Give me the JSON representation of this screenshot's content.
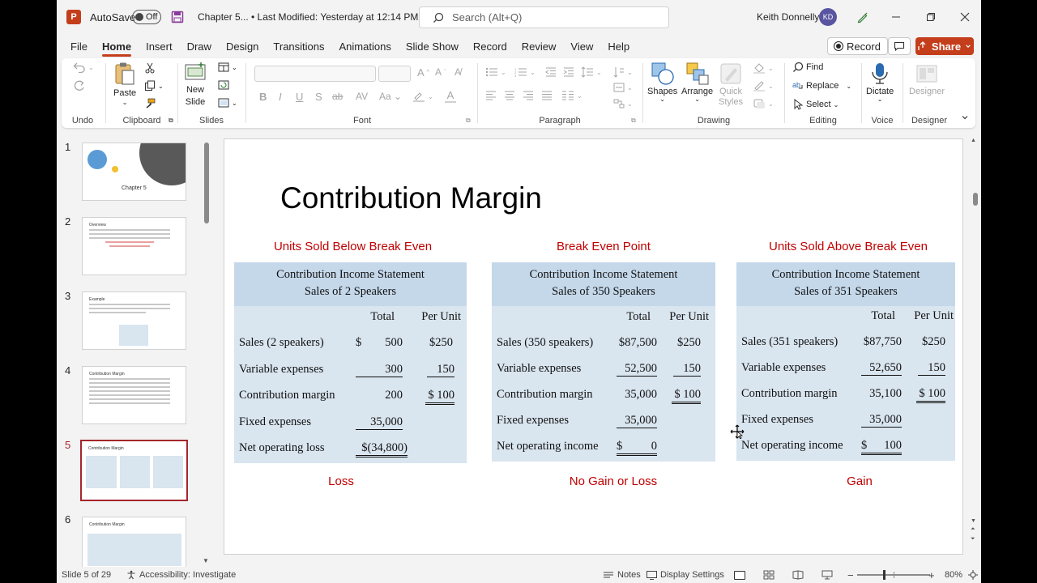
{
  "titlebar": {
    "autosave_label": "AutoSave",
    "autosave_state": "Off",
    "file_name": "Chapter 5...",
    "last_modified": "• Last Modified: Yesterday at 12:14 PM",
    "search_placeholder": "Search (Alt+Q)",
    "user_name": "Keith Donnelly",
    "user_initials": "KD"
  },
  "menu": {
    "tabs": [
      "File",
      "Home",
      "Insert",
      "Draw",
      "Design",
      "Transitions",
      "Animations",
      "Slide Show",
      "Record",
      "Review",
      "View",
      "Help"
    ],
    "active": "Home",
    "record_label": "Record",
    "share_label": "Share"
  },
  "ribbon": {
    "groups": {
      "undo": "Undo",
      "clipboard": "Clipboard",
      "slides": "Slides",
      "font": "Font",
      "paragraph": "Paragraph",
      "drawing": "Drawing",
      "editing": "Editing",
      "voice": "Voice",
      "designer": "Designer"
    },
    "paste_label": "Paste",
    "new_slide_label_1": "New",
    "new_slide_label_2": "Slide",
    "shapes_label": "Shapes",
    "arrange_label": "Arrange",
    "quick_styles_label_1": "Quick",
    "quick_styles_label_2": "Styles",
    "find_label": "Find",
    "replace_label": "Replace",
    "select_label": "Select",
    "dictate_label": "Dictate",
    "designer_label": "Designer"
  },
  "thumbnails": [
    {
      "num": "1",
      "title": "Chapter 5"
    },
    {
      "num": "2",
      "title": "Overview"
    },
    {
      "num": "3",
      "title": "Example"
    },
    {
      "num": "4",
      "title": "Contribution Margin"
    },
    {
      "num": "5",
      "title": "Contribution Margin"
    },
    {
      "num": "6",
      "title": "Contribution Margin"
    }
  ],
  "slide": {
    "title": "Contribution Margin",
    "columns": [
      {
        "heading": "Units Sold Below Break Even",
        "footer": "Loss",
        "statement_title": "Contribution Income Statement",
        "statement_subtitle": "Sales of 2 Speakers",
        "col_total": "Total",
        "col_unit": "Per Unit",
        "rows": [
          {
            "label": "Sales (2 speakers)",
            "cur": "$",
            "total": "500",
            "unit": "$250"
          },
          {
            "label": "Variable expenses",
            "cur": "",
            "total": "300",
            "unit": "150"
          },
          {
            "label": "Contribution margin",
            "cur": "",
            "total": "200",
            "unit": "$ 100"
          },
          {
            "label": "Fixed expenses",
            "cur": "",
            "total": "35,000",
            "unit": ""
          },
          {
            "label": "Net operating loss",
            "cur": "",
            "total": "$(34,800)",
            "unit": ""
          }
        ]
      },
      {
        "heading": "Break Even Point",
        "footer": "No Gain or Loss",
        "statement_title": "Contribution Income Statement",
        "statement_subtitle": "Sales of 350 Speakers",
        "col_total": "Total",
        "col_unit": "Per Unit",
        "rows": [
          {
            "label": "Sales (350 speakers)",
            "cur": "",
            "total": "$87,500",
            "unit": "$250"
          },
          {
            "label": "Variable expenses",
            "cur": "",
            "total": "52,500",
            "unit": "150"
          },
          {
            "label": "Contribution margin",
            "cur": "",
            "total": "35,000",
            "unit": "$ 100"
          },
          {
            "label": "Fixed expenses",
            "cur": "",
            "total": "35,000",
            "unit": ""
          },
          {
            "label": "Net operating income",
            "cur": "$",
            "total": "0",
            "unit": ""
          }
        ]
      },
      {
        "heading": "Units Sold Above Break Even",
        "footer": "Gain",
        "statement_title": "Contribution Income Statement",
        "statement_subtitle": "Sales of 351 Speakers",
        "col_total": "Total",
        "col_unit": "Per Unit",
        "rows": [
          {
            "label": "Sales (351 speakers)",
            "cur": "",
            "total": "$87,750",
            "unit": "$250"
          },
          {
            "label": "Variable expenses",
            "cur": "",
            "total": "52,650",
            "unit": "150"
          },
          {
            "label": "Contribution margin",
            "cur": "",
            "total": "35,100",
            "unit": "$ 100"
          },
          {
            "label": "Fixed expenses",
            "cur": "",
            "total": "35,000",
            "unit": ""
          },
          {
            "label": "Net operating income",
            "cur": "$",
            "total": "100",
            "unit": ""
          }
        ]
      }
    ]
  },
  "status": {
    "slide_count": "Slide 5 of 29",
    "accessibility": "Accessibility: Investigate",
    "notes": "Notes",
    "display_settings": "Display Settings",
    "zoom": "80%"
  }
}
